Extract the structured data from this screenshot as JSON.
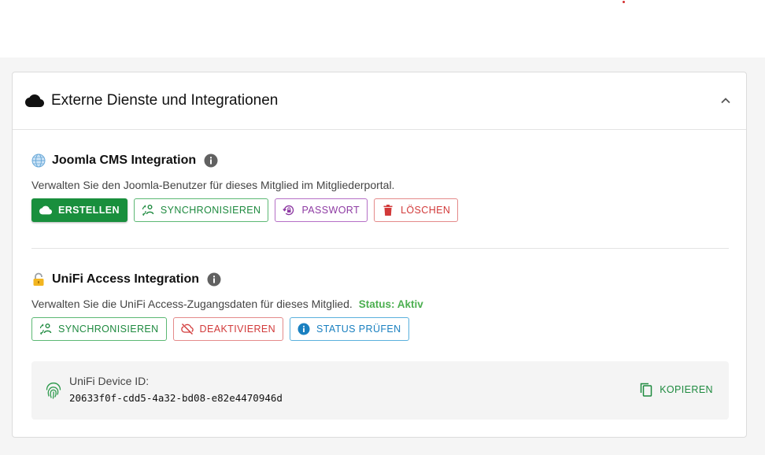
{
  "card": {
    "title": "Externe Dienste und Integrationen",
    "icons": {
      "header": "cloud-icon",
      "collapse": "chevron-up-icon"
    }
  },
  "joomla": {
    "title": "Joomla CMS Integration",
    "description": "Verwalten Sie den Joomla-Benutzer für dieses Mitglied im Mitgliederportal.",
    "buttons": {
      "create": "ERSTELLEN",
      "sync": "SYNCHRONISIEREN",
      "password": "PASSWORT",
      "delete": "LÖSCHEN"
    }
  },
  "unifi": {
    "title": "UniFi Access Integration",
    "description": "Verwalten Sie die UniFi Access-Zugangsdaten für dieses Mitglied.",
    "status": "Status: Aktiv",
    "buttons": {
      "sync": "SYNCHRONISIEREN",
      "deactivate": "DEAKTIVIEREN",
      "check_status": "STATUS PRÜFEN"
    },
    "device": {
      "label": "UniFi Device ID:",
      "id": "20633f0f-cdd5-4a32-bd08-e82e4470946d",
      "copy_label": "KOPIEREN"
    }
  },
  "colors": {
    "primary_green": "#198f3d",
    "success_text": "#4caf50",
    "purple": "#8e3ba3",
    "danger": "#d23a3a",
    "info": "#1a80c0"
  }
}
